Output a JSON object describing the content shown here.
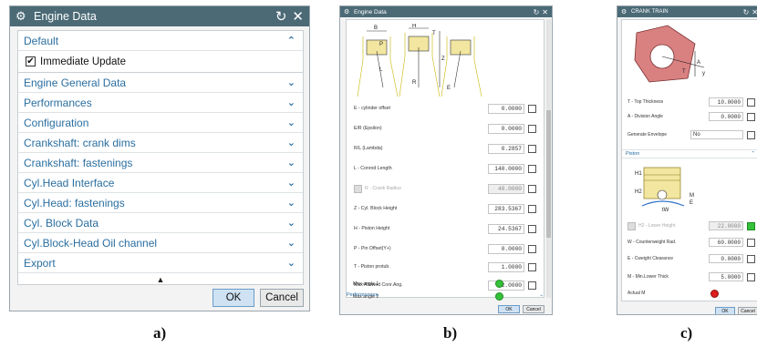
{
  "captions": {
    "a": "a)",
    "b": "b)",
    "c": "c)"
  },
  "icons": {
    "settings": "⚙",
    "reset": "↻",
    "close": "✕",
    "collapse": "⌃",
    "expand": "⌄",
    "scroll_up": "▲"
  },
  "colors": {
    "titlebar": "#4b6a76",
    "link": "#2a6ea0",
    "ok_button": "#cfe2f3",
    "green_indicator": "#35c23a",
    "red_indicator": "#dd1c1c",
    "crank_part": "#d98080"
  },
  "dialog_a": {
    "title": "Engine Data",
    "sections": [
      {
        "label": "Default",
        "expanded": true
      },
      {
        "label": "Engine General Data",
        "expanded": false
      },
      {
        "label": "Performances",
        "expanded": false
      },
      {
        "label": "Configuration",
        "expanded": false
      },
      {
        "label": "Crankshaft: crank dims",
        "expanded": false
      },
      {
        "label": "Crankshaft: fastenings",
        "expanded": false
      },
      {
        "label": "Cyl.Head Interface",
        "expanded": false
      },
      {
        "label": "Cyl.Head: fastenings",
        "expanded": false
      },
      {
        "label": "Cyl. Block Data",
        "expanded": false
      },
      {
        "label": "Cyl.Block-Head Oil channel",
        "expanded": false
      },
      {
        "label": "Export",
        "expanded": false
      }
    ],
    "immediate_update": {
      "label": "Immediate Update",
      "checked": true
    },
    "ok_label": "OK",
    "cancel_label": "Cancel"
  },
  "dialog_b": {
    "title": "Engine Data",
    "schematic_labels": [
      "B",
      "H",
      "T",
      "P",
      "Z",
      "R",
      "E",
      "L"
    ],
    "params": [
      {
        "label": "E - cylinder offset",
        "value": "0.0000",
        "enabled": true
      },
      {
        "label": "E/R (Epsilon)",
        "value": "0.0000",
        "enabled": true
      },
      {
        "label": "R/L (Lambda)",
        "value": "0.2857",
        "enabled": true
      },
      {
        "label": "L - Conrod Length",
        "value": "140.0000",
        "enabled": true
      },
      {
        "label": "R - Crank Radius",
        "value": "40.0000",
        "enabled": false
      },
      {
        "label": "Z - Cyl. Block Height",
        "value": "283.5367",
        "enabled": true
      },
      {
        "label": "H - Piston Height",
        "value": "24.5367",
        "enabled": true
      },
      {
        "label": "P - Pin Offset(Y+)",
        "value": "0.0000",
        "enabled": true
      },
      {
        "label": "T - Piston protub.",
        "value": "1.0000",
        "enabled": true
      },
      {
        "label": "Max Allowed Conr.Ang.",
        "value": "22.0000",
        "enabled": true
      }
    ],
    "indicators": [
      {
        "label": "Max angle 1"
      },
      {
        "label": "Max angle 2"
      }
    ],
    "collapsed_section": "Performances",
    "ok_label": "OK",
    "cancel_label": "Cancel"
  },
  "dialog_c": {
    "title": "CRANK TRAIN",
    "diagram_labels": [
      "A",
      "T",
      "y"
    ],
    "params_top": [
      {
        "label": "T - Top Thickness",
        "value": "10.0000"
      },
      {
        "label": "A - Division Angle",
        "value": "0.0000"
      }
    ],
    "generate_envelope": {
      "label": "Generate Envelope",
      "value": "No"
    },
    "piston_section": "Piston",
    "piston_labels": [
      "H1",
      "H2",
      "tW",
      "M",
      "E"
    ],
    "params_piston": [
      {
        "label": "H2 - Lower Height",
        "value": "22.0000",
        "enabled": false
      },
      {
        "label": "W - Counterweight Rad.",
        "value": "60.0000",
        "enabled": true
      },
      {
        "label": "E - Cweight Clearance",
        "value": "0.0000",
        "enabled": true
      },
      {
        "label": "M - Min.Lower Thick",
        "value": "5.0000",
        "enabled": true
      }
    ],
    "actual_m": {
      "label": "Actual M"
    },
    "ok_label": "OK",
    "cancel_label": "Cancel"
  }
}
